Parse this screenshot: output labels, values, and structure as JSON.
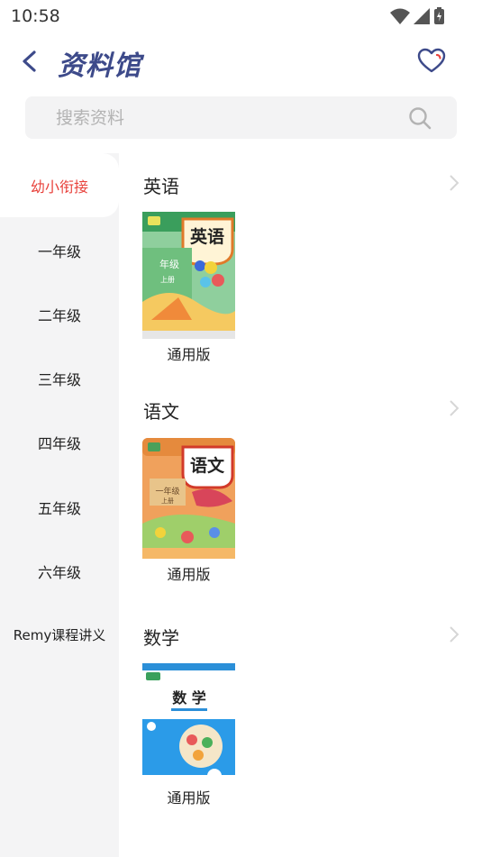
{
  "status": {
    "time": "10:58"
  },
  "header": {
    "title": "资料馆"
  },
  "search": {
    "placeholder": "搜索资料"
  },
  "sidebar": {
    "items": [
      {
        "label": "幼小衔接",
        "active": true
      },
      {
        "label": "一年级"
      },
      {
        "label": "二年级"
      },
      {
        "label": "三年级"
      },
      {
        "label": "四年级"
      },
      {
        "label": "五年级"
      },
      {
        "label": "六年级"
      },
      {
        "label": "Remy课程讲义"
      }
    ]
  },
  "sections": [
    {
      "title": "英语",
      "book": {
        "label": "通用版",
        "cover_title": "英语",
        "cover_grade": "年级",
        "cover_volume": "上册"
      }
    },
    {
      "title": "语文",
      "book": {
        "label": "通用版",
        "cover_title": "语文",
        "cover_grade": "一年级",
        "cover_volume": "上册"
      }
    },
    {
      "title": "数学",
      "book": {
        "label": "通用版",
        "cover_title": "数 学"
      }
    }
  ],
  "colors": {
    "accent": "#e8423c",
    "title": "#3d4a8a",
    "sidebar_bg": "#f4f4f5"
  },
  "icons": [
    "battery-icon",
    "signal-icon",
    "wifi-icon",
    "back-arrow-icon",
    "heart-icon",
    "search-icon",
    "chevron-right-icon"
  ]
}
